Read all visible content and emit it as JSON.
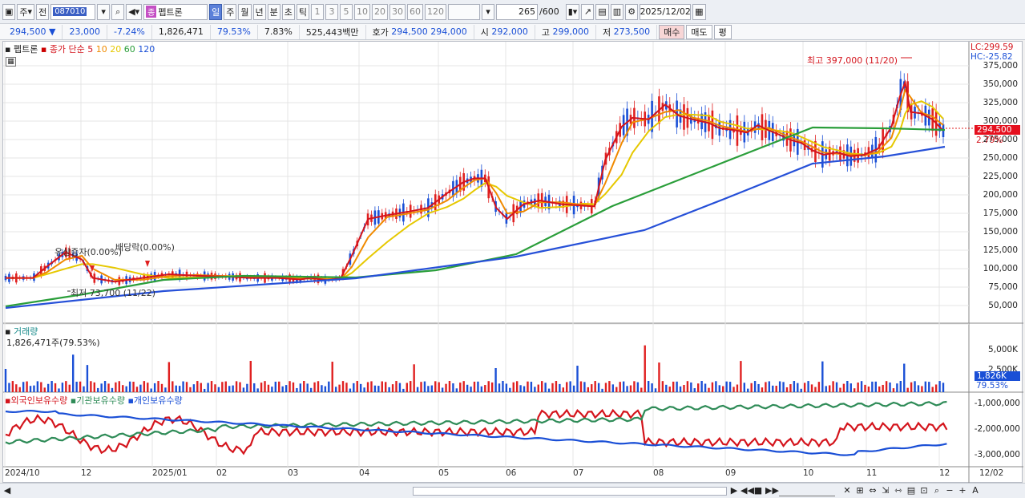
{
  "toolbar": {
    "mode": "주",
    "prev": "전",
    "code": "087010",
    "badge": "종",
    "name": "펩트론",
    "periods": [
      "일",
      "주",
      "월",
      "년",
      "분",
      "초",
      "틱"
    ],
    "intervals": [
      "1",
      "3",
      "5",
      "10",
      "20",
      "30",
      "60",
      "120"
    ],
    "count": "265",
    "count_total": "/600",
    "date": "2025/12/02"
  },
  "quote": {
    "price": "294,500",
    "change": "23,000",
    "change_pct": "-7.24%",
    "volume": "1,826,471",
    "vol_ratio": "79.53%",
    "turnover": "7.83%",
    "amount": "525,443백만",
    "bid_label": "호가",
    "ask": "294,500",
    "bid": "294,000",
    "open_label": "시",
    "open": "292,000",
    "high_label": "고",
    "high": "299,000",
    "low_label": "저",
    "low": "273,500",
    "buy": "매수",
    "sell": "매도",
    "eval": "평"
  },
  "price_panel": {
    "stock": "펩트론",
    "ma_legend": "종가 단순",
    "ma": [
      {
        "v": "5",
        "c": "#d4141c"
      },
      {
        "v": "10",
        "c": "#f08a00"
      },
      {
        "v": "20",
        "c": "#e6c800"
      },
      {
        "v": "60",
        "c": "#2a9e3a"
      },
      {
        "v": "120",
        "c": "#1a4fd6"
      }
    ],
    "lc": "LC:299.59",
    "hc": "HC:-25.82",
    "y_ticks": [
      "375,000",
      "350,000",
      "325,000",
      "300,000",
      "275,000",
      "250,000",
      "225,000",
      "200,000",
      "175,000",
      "150,000",
      "125,000",
      "100,000",
      "75,000",
      "50,000"
    ],
    "current_price": "294,500",
    "current_pct": "2.79%",
    "high_note": "최고 397,000 (11/20)",
    "low_note": "최저 73,700 (11/22)",
    "event1": "유상증자(0.00%)",
    "event2": "배당락(0.00%)"
  },
  "volume_panel": {
    "title": "거래량",
    "value": "1,826,471주(79.53%)",
    "y_ticks": [
      "5,000K",
      "2,500K"
    ],
    "current": "1,826K",
    "current_pct": "79.53%"
  },
  "holding_panel": {
    "series": [
      {
        "name": "외국인보유수량",
        "c": "#d4141c"
      },
      {
        "name": "기관보유수량",
        "c": "#2e8b57"
      },
      {
        "name": "개인보유수량",
        "c": "#1a4fd6"
      }
    ],
    "y_ticks": [
      "-1,000,000",
      "-2,000,000",
      "-3,000,000"
    ]
  },
  "x_axis": [
    "2024/10",
    "12",
    "2025/01",
    "02",
    "03",
    "04",
    "05",
    "06",
    "07",
    "08",
    "09",
    "10",
    "11",
    "12",
    "12/02"
  ]
}
